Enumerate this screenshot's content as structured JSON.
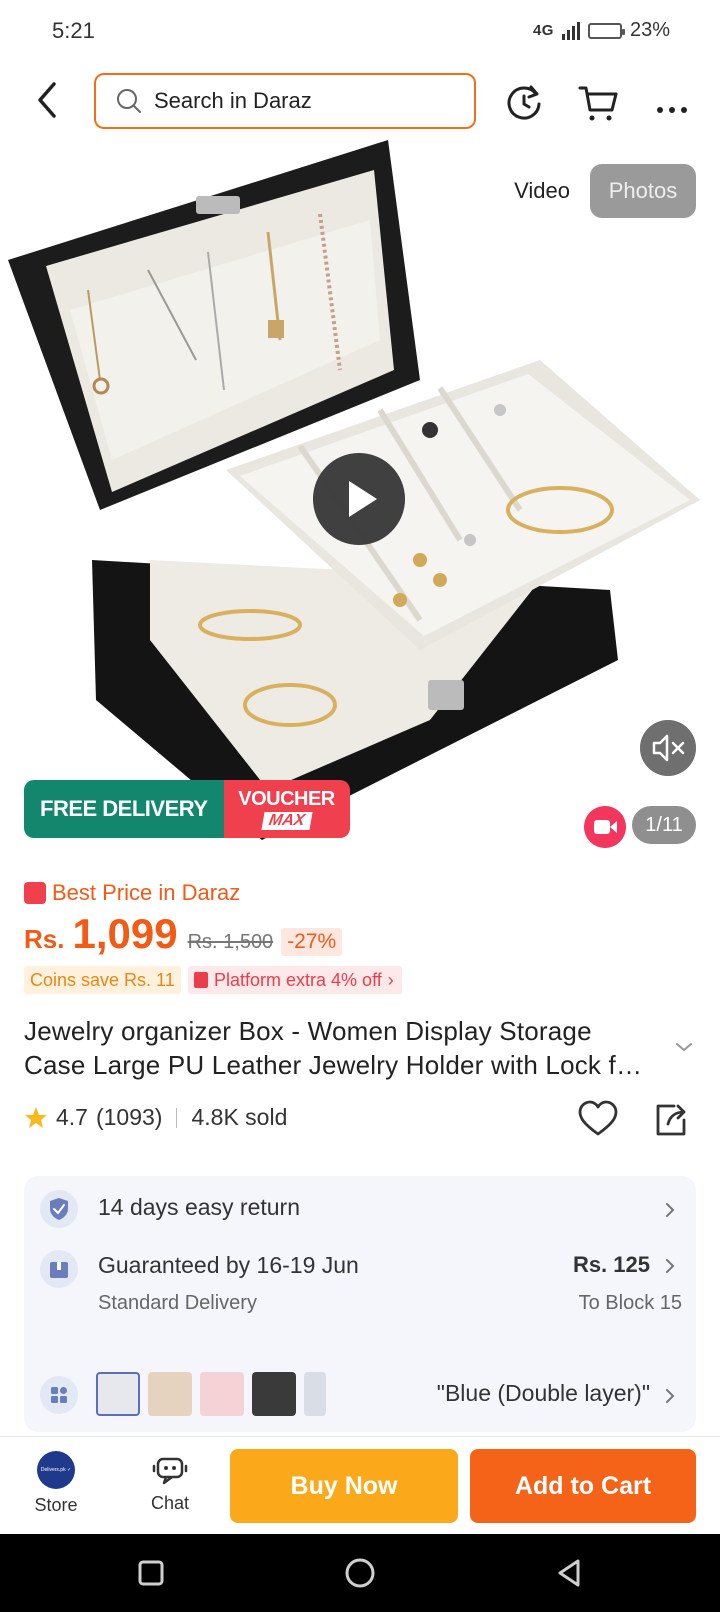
{
  "status_bar": {
    "time": "5:21",
    "network": "4G",
    "battery": "23%",
    "battery_level": 0.23
  },
  "header": {
    "search_placeholder": "Search in Daraz"
  },
  "media": {
    "toggle_video": "Video",
    "toggle_photos": "Photos",
    "promo_free_delivery": "FREE DELIVERY",
    "promo_voucher": "VOUCHER",
    "promo_voucher_max": "MAX",
    "counter": "1/11"
  },
  "price": {
    "badge": "Best Price in Daraz",
    "currency": "Rs.",
    "current": "1,099",
    "original": "Rs. 1,500",
    "discount": "-27%",
    "coins": "Coins save Rs. 11",
    "platform": "Platform extra 4% off"
  },
  "product": {
    "title": "Jewelry organizer Box - Women Display Storage Case Large PU Leather Jewelry Holder with Lock for Necklaces, Rings, Earrings",
    "rating": "4.7",
    "reviews": "(1093)",
    "sold": "4.8K sold"
  },
  "service": {
    "return": "14 days easy return",
    "delivery_guarantee": "Guaranteed by 16-19 Jun",
    "delivery_type": "Standard Delivery",
    "delivery_price": "Rs. 125",
    "delivery_location": "To Block 15",
    "variant": "\"Blue (Double layer)\""
  },
  "bottom_bar": {
    "store_label": "Store",
    "store_logo_text": "Delivers.pk ✓",
    "chat_label": "Chat",
    "buy_now": "Buy Now",
    "add_to_cart": "Add to Cart"
  },
  "colors": {
    "accent": "#f25a16",
    "buy_now": "#fba91a",
    "add_to_cart": "#f56318",
    "free_delivery": "#13866e",
    "voucher": "#f0404e"
  }
}
